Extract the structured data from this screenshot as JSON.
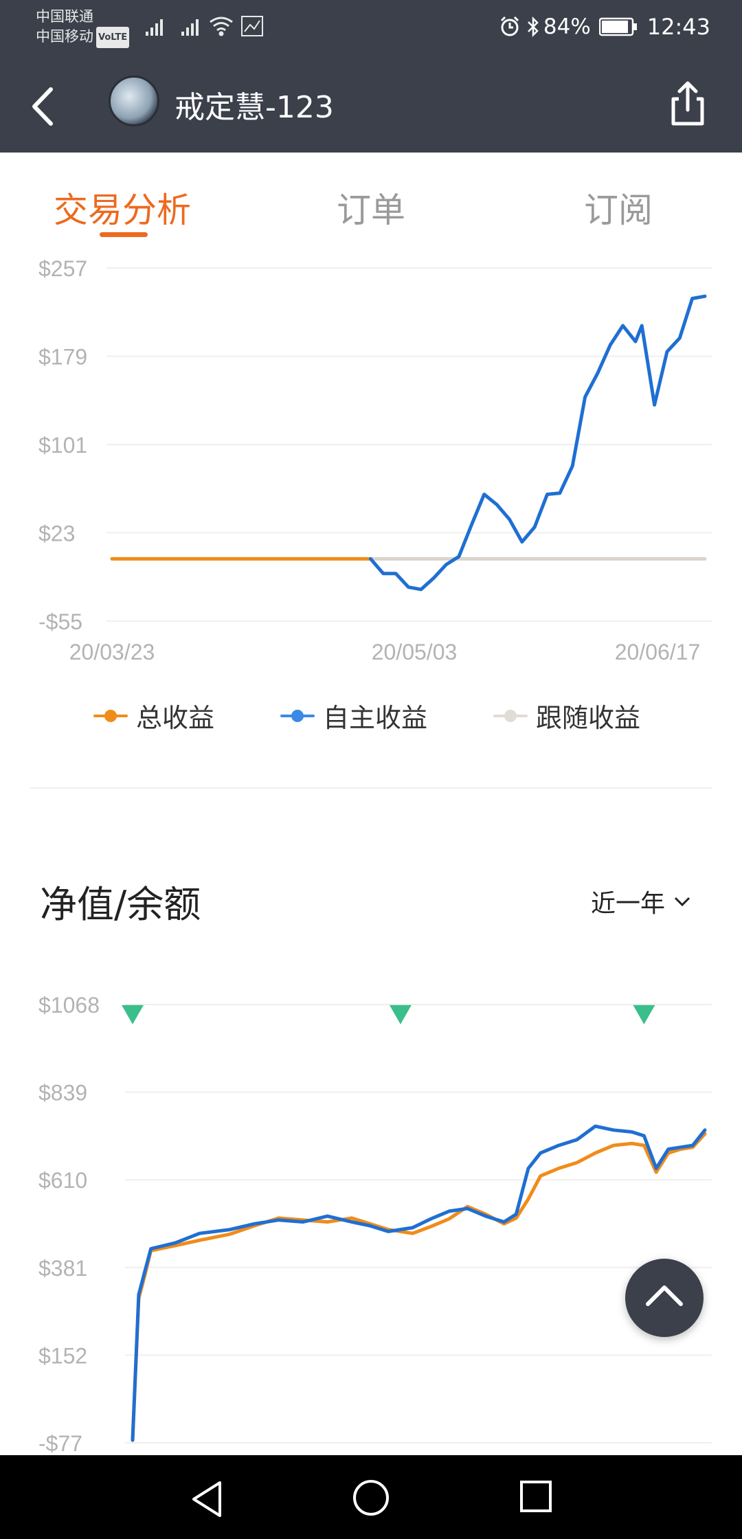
{
  "status_bar": {
    "carrier_1": "中国联通",
    "carrier_2": "中国移动",
    "volte_badge": "VoLTE",
    "battery_percent": "84%",
    "time": "12:43",
    "icons": [
      "signal-icon",
      "signal-icon",
      "wifi-icon",
      "network-speed-icon",
      "alarm-icon",
      "bluetooth-icon",
      "battery-icon"
    ]
  },
  "header": {
    "title": "戒定慧-123",
    "icons": [
      "back-arrow-icon",
      "avatar",
      "share-icon"
    ]
  },
  "tabs": [
    {
      "label": "交易分析",
      "active": true
    },
    {
      "label": "订单",
      "active": false
    },
    {
      "label": "订阅",
      "active": false
    }
  ],
  "colors": {
    "accent": "#ec6a1f",
    "total_profit": "#f08c1a",
    "self_profit": "#1f6fd2",
    "follow_profit": "#d9d3cc",
    "marker": "#3bbf8a",
    "header_bg": "#3b404b"
  },
  "chart_data": [
    {
      "type": "line",
      "y_ticks": [
        "$257",
        "$179",
        "$101",
        "$23",
        "-$55"
      ],
      "x_ticks": [
        "20/03/23",
        "20/05/03",
        "20/06/17"
      ],
      "ylim": [
        -55,
        257
      ],
      "x_range": [
        "2020-03-23",
        "2020-06-25"
      ],
      "grid": true,
      "legend": [
        {
          "name": "总收益",
          "color": "#f08c1a"
        },
        {
          "name": "自主收益",
          "color": "#1f6fd2"
        },
        {
          "name": "跟随收益",
          "color": "#d9d3cc"
        }
      ],
      "series": [
        {
          "name": "跟随收益",
          "color": "#d9d3cc",
          "points": [
            [
              "2020-03-23",
              0
            ],
            [
              "2020-06-25",
              0
            ]
          ]
        },
        {
          "name": "总收益",
          "color": "#f08c1a",
          "points": [
            [
              "2020-03-23",
              0
            ],
            [
              "2020-05-03",
              0
            ]
          ]
        },
        {
          "name": "自主收益",
          "color": "#1f6fd2",
          "points": [
            [
              "2020-05-03",
              0
            ],
            [
              "2020-05-05",
              -13
            ],
            [
              "2020-05-07",
              -13
            ],
            [
              "2020-05-09",
              -25
            ],
            [
              "2020-05-11",
              -27
            ],
            [
              "2020-05-13",
              -17
            ],
            [
              "2020-05-15",
              -5
            ],
            [
              "2020-05-17",
              2
            ],
            [
              "2020-05-19",
              30
            ],
            [
              "2020-05-21",
              57
            ],
            [
              "2020-05-23",
              48
            ],
            [
              "2020-05-25",
              35
            ],
            [
              "2020-05-27",
              15
            ],
            [
              "2020-05-29",
              28
            ],
            [
              "2020-05-31",
              57
            ],
            [
              "2020-06-02",
              58
            ],
            [
              "2020-06-04",
              82
            ],
            [
              "2020-06-06",
              143
            ],
            [
              "2020-06-08",
              164
            ],
            [
              "2020-06-10",
              189
            ],
            [
              "2020-06-12",
              206
            ],
            [
              "2020-06-14",
              192
            ],
            [
              "2020-06-15",
              206
            ],
            [
              "2020-06-17",
              136
            ],
            [
              "2020-06-19",
              183
            ],
            [
              "2020-06-21",
              195
            ],
            [
              "2020-06-23",
              230
            ],
            [
              "2020-06-25",
              232
            ]
          ]
        }
      ]
    },
    {
      "type": "line",
      "title": "净值/余额",
      "range_selector": "近一年",
      "y_ticks": [
        "$1068",
        "$839",
        "$610",
        "$381",
        "$152",
        "-$77"
      ],
      "ylim": [
        -77,
        1068
      ],
      "x_range": [
        "2020-03-23",
        "2020-06-25"
      ],
      "markers_value": 1045,
      "markers": [
        "2020-03-23",
        "2020-05-06",
        "2020-06-15"
      ],
      "grid": true,
      "series": [
        {
          "name": "总收益",
          "color": "#f08c1a",
          "points": [
            [
              "2020-03-23",
              -70
            ],
            [
              "2020-03-24",
              300
            ],
            [
              "2020-03-25",
              360
            ],
            [
              "2020-03-26",
              425
            ],
            [
              "2020-03-30",
              438
            ],
            [
              "2020-04-03",
              452
            ],
            [
              "2020-04-08",
              468
            ],
            [
              "2020-04-12",
              490
            ],
            [
              "2020-04-16",
              510
            ],
            [
              "2020-04-20",
              505
            ],
            [
              "2020-04-24",
              500
            ],
            [
              "2020-04-28",
              510
            ],
            [
              "2020-05-01",
              495
            ],
            [
              "2020-05-04",
              480
            ],
            [
              "2020-05-08",
              470
            ],
            [
              "2020-05-11",
              488
            ],
            [
              "2020-05-14",
              508
            ],
            [
              "2020-05-17",
              540
            ],
            [
              "2020-05-20",
              520
            ],
            [
              "2020-05-23",
              495
            ],
            [
              "2020-05-25",
              510
            ],
            [
              "2020-05-27",
              560
            ],
            [
              "2020-05-29",
              620
            ],
            [
              "2020-06-01",
              640
            ],
            [
              "2020-06-04",
              655
            ],
            [
              "2020-06-07",
              680
            ],
            [
              "2020-06-10",
              700
            ],
            [
              "2020-06-13",
              705
            ],
            [
              "2020-06-15",
              700
            ],
            [
              "2020-06-17",
              630
            ],
            [
              "2020-06-19",
              680
            ],
            [
              "2020-06-21",
              690
            ],
            [
              "2020-06-23",
              695
            ],
            [
              "2020-06-25",
              730
            ]
          ]
        },
        {
          "name": "自主收益",
          "color": "#1f6fd2",
          "points": [
            [
              "2020-03-23",
              -70
            ],
            [
              "2020-03-24",
              310
            ],
            [
              "2020-03-25",
              370
            ],
            [
              "2020-03-26",
              430
            ],
            [
              "2020-03-30",
              445
            ],
            [
              "2020-04-03",
              470
            ],
            [
              "2020-04-08",
              480
            ],
            [
              "2020-04-12",
              495
            ],
            [
              "2020-04-16",
              505
            ],
            [
              "2020-04-20",
              500
            ],
            [
              "2020-04-24",
              515
            ],
            [
              "2020-04-28",
              500
            ],
            [
              "2020-05-01",
              490
            ],
            [
              "2020-05-04",
              475
            ],
            [
              "2020-05-08",
              485
            ],
            [
              "2020-05-11",
              508
            ],
            [
              "2020-05-14",
              528
            ],
            [
              "2020-05-17",
              535
            ],
            [
              "2020-05-20",
              515
            ],
            [
              "2020-05-23",
              500
            ],
            [
              "2020-05-25",
              520
            ],
            [
              "2020-05-27",
              640
            ],
            [
              "2020-05-29",
              680
            ],
            [
              "2020-06-01",
              700
            ],
            [
              "2020-06-04",
              715
            ],
            [
              "2020-06-07",
              750
            ],
            [
              "2020-06-10",
              740
            ],
            [
              "2020-06-13",
              735
            ],
            [
              "2020-06-15",
              725
            ],
            [
              "2020-06-17",
              640
            ],
            [
              "2020-06-19",
              690
            ],
            [
              "2020-06-21",
              695
            ],
            [
              "2020-06-23",
              700
            ],
            [
              "2020-06-25",
              740
            ]
          ]
        }
      ]
    }
  ],
  "fab": {
    "icon": "chevron-up-icon"
  },
  "system_nav": {
    "icons": [
      "back-triangle-icon",
      "home-circle-icon",
      "recents-square-icon"
    ]
  }
}
